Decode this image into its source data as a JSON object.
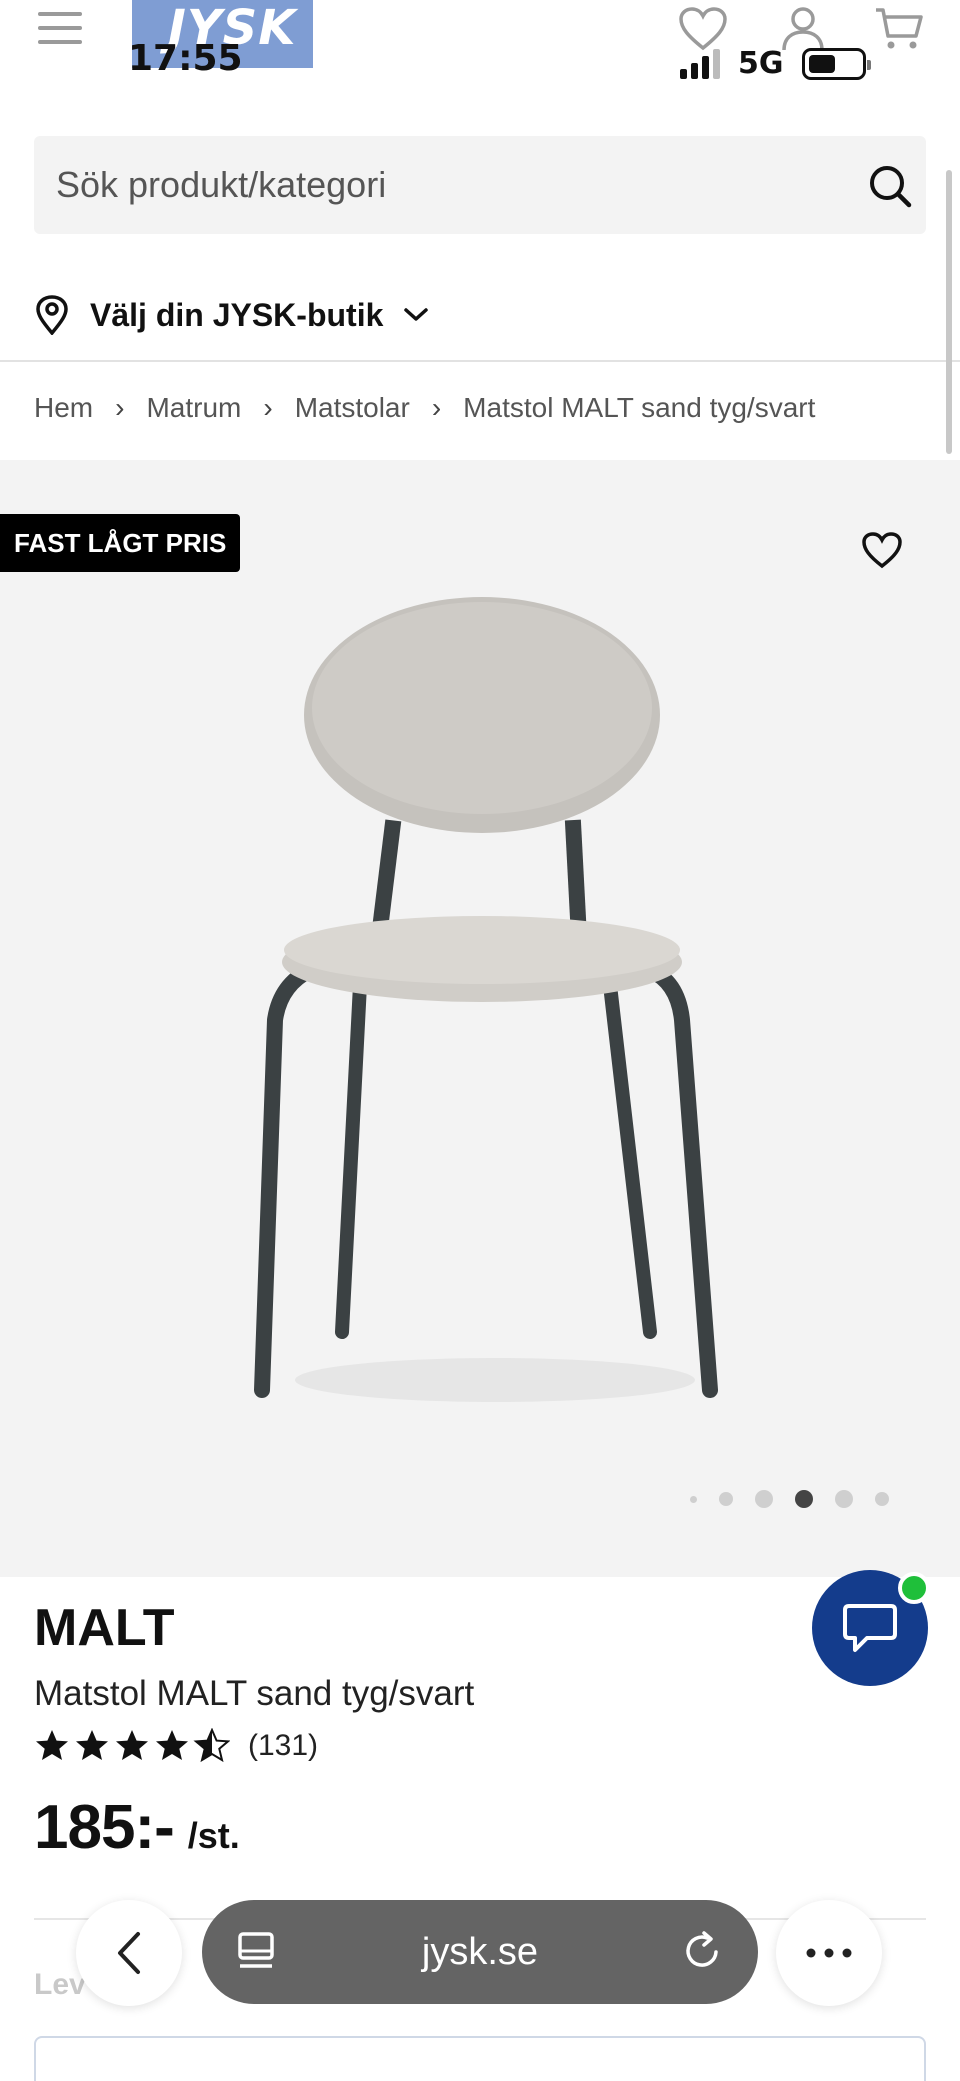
{
  "status_bar": {
    "time": "17:55",
    "network": "5G"
  },
  "header": {
    "logo_text": "JYSK"
  },
  "search": {
    "placeholder": "Sök produkt/kategori"
  },
  "store_picker": {
    "label": "Välj din JYSK-butik"
  },
  "breadcrumb": {
    "items": [
      "Hem",
      "Matrum",
      "Matstolar",
      "Matstol MALT sand tyg/svart"
    ],
    "separator": "›"
  },
  "product": {
    "badge": "FAST LÅGT PRIS",
    "brand": "MALT",
    "name": "Matstol MALT sand tyg/svart",
    "rating": 4.5,
    "rating_count": "(131)",
    "price": "185:-",
    "price_unit": "/st.",
    "image_count": 6,
    "active_image_index": 3,
    "next_section_partial": "Lev     s ell"
  },
  "browser": {
    "url": "jysk.se"
  },
  "colors": {
    "chat_button": "#143c8c",
    "online_dot": "#1fbf3a",
    "badge_bg": "#000000",
    "hero_bg": "#f3f3f3",
    "logo_bg": "#7f9dd3"
  }
}
